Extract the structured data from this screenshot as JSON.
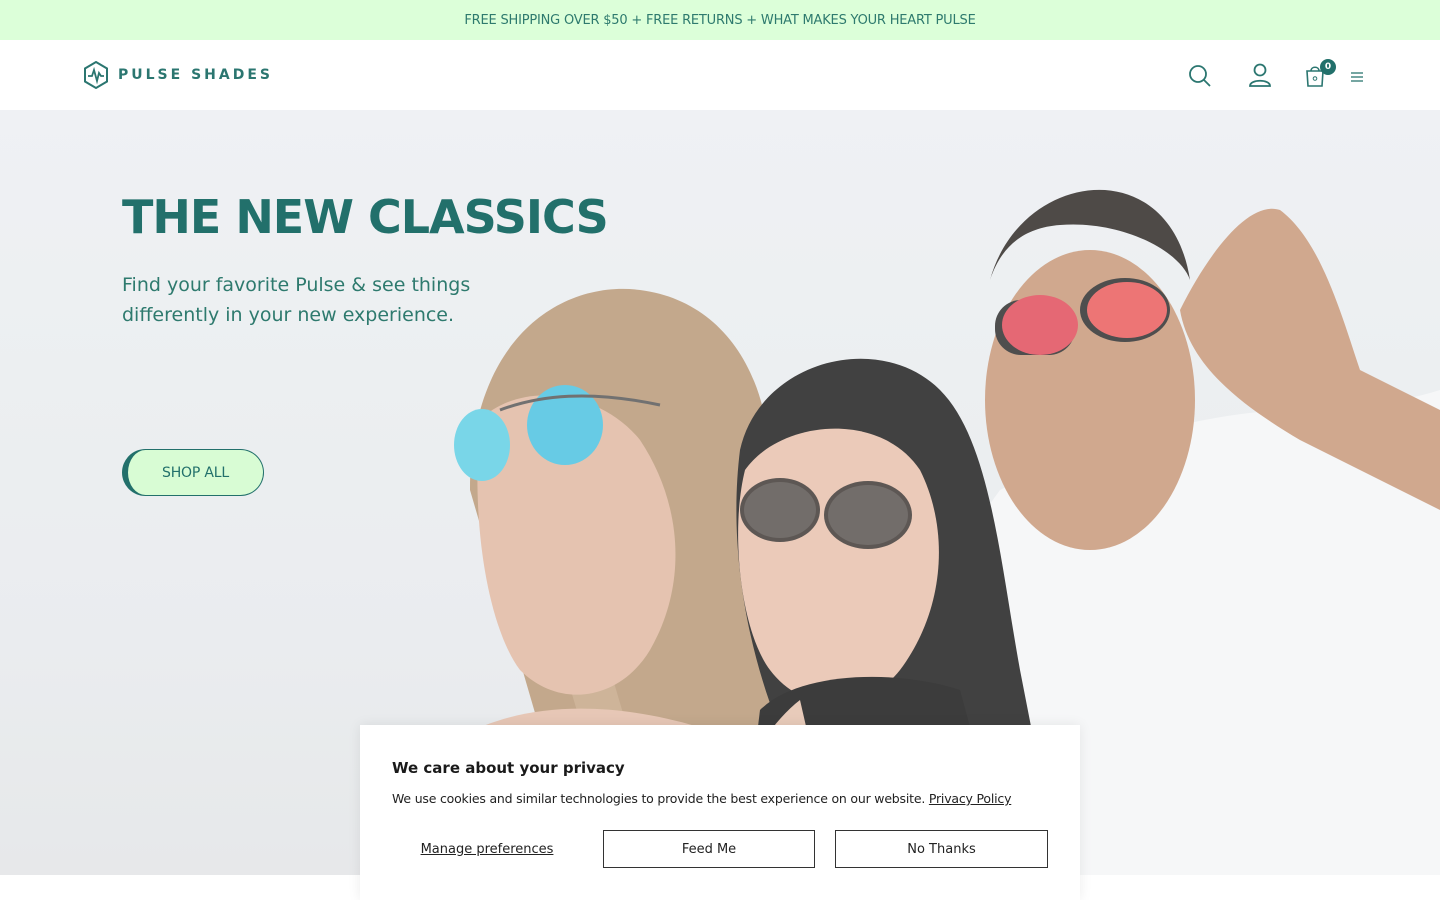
{
  "announcement": {
    "text": "FREE SHIPPING OVER $50 + FREE RETURNS + WHAT MAKES YOUR HEART PULSE"
  },
  "header": {
    "logo_text": "PULSE SHADES",
    "cart_count": "0",
    "icons": [
      "pulse-logo-icon",
      "search-icon",
      "account-icon",
      "cart-icon",
      "menu-icon"
    ]
  },
  "hero": {
    "title": "THE NEW CLASSICS",
    "subtitle": "Find your favorite Pulse & see things differently in your new experience.",
    "cta_label": "SHOP ALL"
  },
  "consent": {
    "title": "We care about your privacy",
    "text": "We use cookies and similar technologies to provide the best experience on our website.",
    "policy_link": "Privacy Policy",
    "manage_label": "Manage preferences",
    "accept_label": "Feed Me",
    "decline_label": "No Thanks"
  },
  "colors": {
    "brand": "#22706b",
    "announcement_bg": "#dcffd9",
    "cta_bg": "#d8fcd4"
  }
}
